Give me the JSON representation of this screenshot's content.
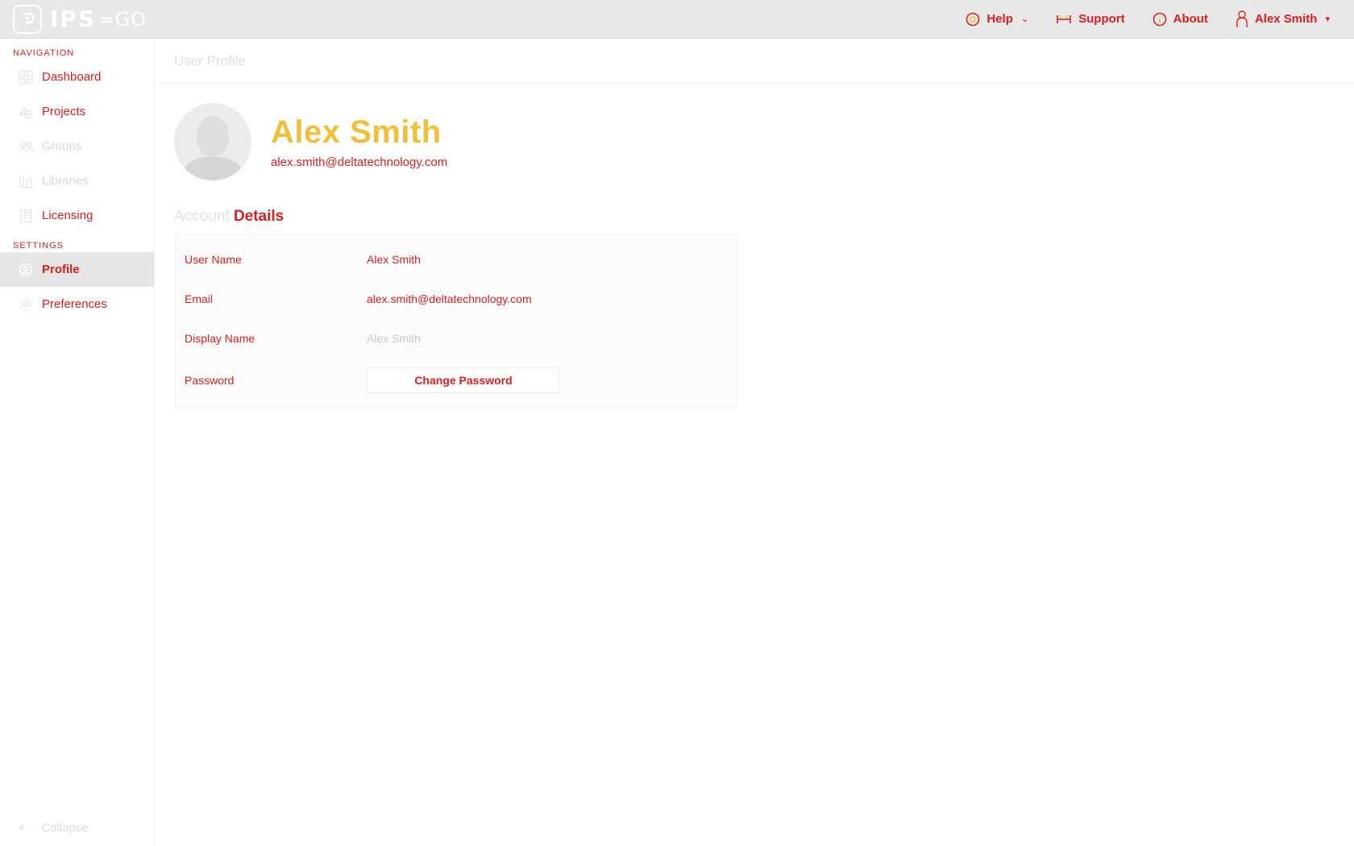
{
  "app": {
    "logo_text": "IPS",
    "logo_sub": "GO"
  },
  "topbar": {
    "help_label": "Help",
    "support_label": "Support",
    "about_label": "About",
    "user_label": "Alex Smith"
  },
  "sidebar": {
    "nav_title": "Navigation",
    "items": [
      {
        "label": "Dashboard",
        "icon": "grid-icon"
      },
      {
        "label": "Projects",
        "icon": "shapes-icon"
      },
      {
        "label": "Groups",
        "icon": "users-icon"
      },
      {
        "label": "Libraries",
        "icon": "library-icon"
      },
      {
        "label": "Licensing",
        "icon": "license-icon"
      }
    ],
    "settings_title": "Settings",
    "settings_items": [
      {
        "label": "Profile",
        "icon": "user-circle-icon",
        "active": true
      },
      {
        "label": "Preferences",
        "icon": "gear-icon"
      }
    ],
    "collapse_label": "Collapse"
  },
  "page": {
    "title": "User Profile",
    "name": "Alex Smith",
    "email": "alex.smith@deltatechnology.com",
    "account_title_a": "Account",
    "account_title_b": "Details",
    "details": [
      {
        "key": "User Name",
        "value": "Alex Smith"
      },
      {
        "key": "Email",
        "value": "alex.smith@deltatechnology.com"
      },
      {
        "key": "Display Name",
        "value": "Alex Smith"
      }
    ],
    "password_label": "Password",
    "change_password_label": "Change Password"
  },
  "colors": {
    "accent": "#d92020",
    "name": "#f0c03a",
    "topbar": "#e8e8e8"
  }
}
